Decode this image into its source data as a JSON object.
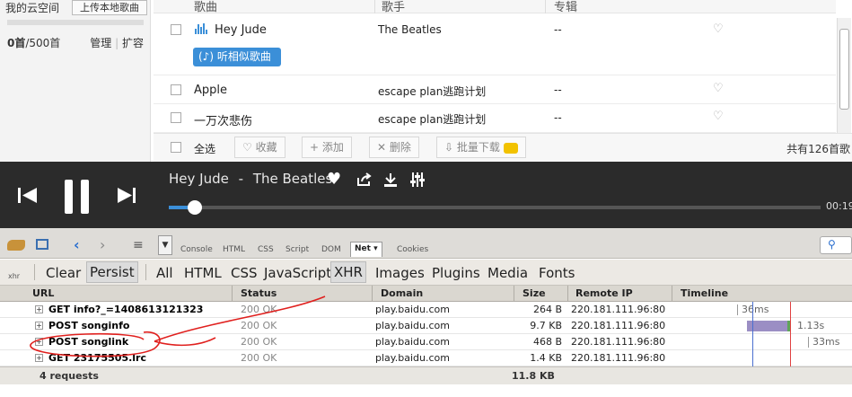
{
  "cloud": {
    "title": "我的云空间",
    "upload_label": "上传本地歌曲",
    "used": "0首",
    "capacity": "/500首",
    "manage": "管理",
    "expand": "扩容",
    "divider": "|"
  },
  "song_table": {
    "headers": {
      "song": "歌曲",
      "artist": "歌手",
      "album": "专辑"
    },
    "rows": [
      {
        "title": "Hey Jude",
        "artist": "The Beatles",
        "album": "--"
      },
      {
        "title": "Apple",
        "artist": "escape plan逃跑计划",
        "album": "--"
      },
      {
        "title": "一万次悲伤",
        "artist": "escape plan逃跑计划",
        "album": "--"
      }
    ],
    "similar_label": "听相似歌曲",
    "footer": {
      "select_all": "全选",
      "favorite": "收藏",
      "add": "添加",
      "delete": "删除",
      "batch_download": "批量下载",
      "total": "共有126首歌"
    }
  },
  "player": {
    "title": "Hey Jude",
    "separator": "-",
    "artist": "The Beatles",
    "time": "00:19",
    "progress": 0.04
  },
  "firebug": {
    "tabs": [
      "Console",
      "HTML",
      "CSS",
      "Script",
      "DOM",
      "Net",
      "Cookies"
    ],
    "active_tab": "Net ▾",
    "filters": {
      "clear": "Clear",
      "persist": "Persist",
      "all": "All",
      "html": "HTML",
      "css": "CSS",
      "js": "JavaScript",
      "xhr": "XHR",
      "images": "Images",
      "plugins": "Plugins",
      "media": "Media",
      "fonts": "Fonts"
    },
    "xhr_label": "xhr",
    "columns": {
      "url": "URL",
      "status": "Status",
      "domain": "Domain",
      "size": "Size",
      "ip": "Remote IP",
      "timeline": "Timeline"
    },
    "requests": [
      {
        "url": "GET info?_=1408613121323",
        "status": "200 OK",
        "domain": "play.baidu.com",
        "size": "264 B",
        "ip": "220.181.111.96:80",
        "time": "36ms"
      },
      {
        "url": "POST songinfo",
        "status": "200 OK",
        "domain": "play.baidu.com",
        "size": "9.7 KB",
        "ip": "220.181.111.96:80",
        "time": "1.13s"
      },
      {
        "url": "POST songlink",
        "status": "200 OK",
        "domain": "play.baidu.com",
        "size": "468 B",
        "ip": "220.181.111.96:80",
        "time": "33ms"
      },
      {
        "url": "GET 23175505.lrc",
        "status": "200 OK",
        "domain": "play.baidu.com",
        "size": "1.4 KB",
        "ip": "220.181.111.96:80",
        "time": ""
      }
    ],
    "summary": {
      "count": "4 requests",
      "total_size": "11.8 KB"
    }
  },
  "colors": {
    "accent": "#3b8fd8",
    "player_bg": "#2b2b2b",
    "annotation": "#e0201e"
  }
}
